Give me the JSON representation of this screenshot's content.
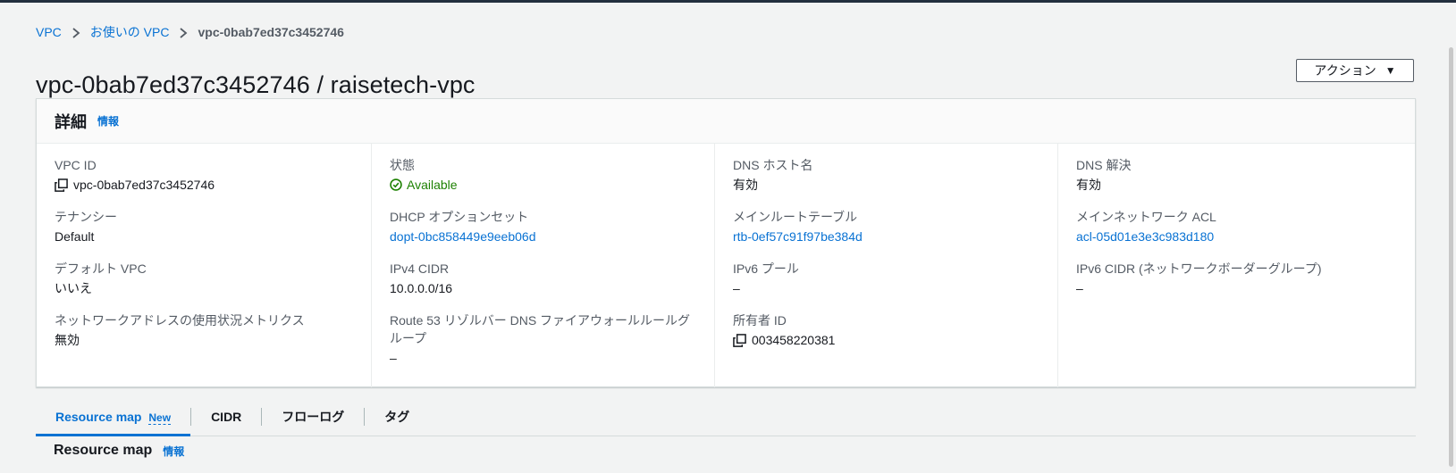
{
  "breadcrumb": {
    "root": "VPC",
    "parent": "お使いの VPC",
    "current": "vpc-0bab7ed37c3452746"
  },
  "page_title": "vpc-0bab7ed37c3452746 / raisetech-vpc",
  "actions_label": "アクション",
  "details": {
    "title": "詳細",
    "info": "情報",
    "fields": {
      "vpc_id": {
        "label": "VPC ID",
        "value": "vpc-0bab7ed37c3452746"
      },
      "state": {
        "label": "状態",
        "value": "Available"
      },
      "dns_hostnames": {
        "label": "DNS ホスト名",
        "value": "有効"
      },
      "dns_resolution": {
        "label": "DNS 解決",
        "value": "有効"
      },
      "tenancy": {
        "label": "テナンシー",
        "value": "Default"
      },
      "dhcp_options": {
        "label": "DHCP オプションセット",
        "value": "dopt-0bc858449e9eeb06d"
      },
      "main_route_table": {
        "label": "メインルートテーブル",
        "value": "rtb-0ef57c91f97be384d"
      },
      "main_network_acl": {
        "label": "メインネットワーク ACL",
        "value": "acl-05d01e3e3c983d180"
      },
      "default_vpc": {
        "label": "デフォルト VPC",
        "value": "いいえ"
      },
      "ipv4_cidr": {
        "label": "IPv4 CIDR",
        "value": "10.0.0.0/16"
      },
      "ipv6_pool": {
        "label": "IPv6 プール",
        "value": "–"
      },
      "ipv6_cidr": {
        "label": "IPv6 CIDR (ネットワークボーダーグループ)",
        "value": "–"
      },
      "net_addr_metrics": {
        "label": "ネットワークアドレスの使用状況メトリクス",
        "value": "無効"
      },
      "route53_dns_fw": {
        "label": "Route 53 リゾルバー DNS ファイアウォールルールグループ",
        "value": "–"
      },
      "owner_id": {
        "label": "所有者 ID",
        "value": "003458220381"
      }
    }
  },
  "tabs": [
    {
      "label": "Resource map",
      "badge": "New"
    },
    {
      "label": "CIDR"
    },
    {
      "label": "フローログ"
    },
    {
      "label": "タグ"
    }
  ],
  "resource_map": {
    "title": "Resource map",
    "info": "情報"
  },
  "colors": {
    "link": "#0972d3",
    "success": "#1d8102",
    "text": "#16191f",
    "muted": "#545b64"
  }
}
